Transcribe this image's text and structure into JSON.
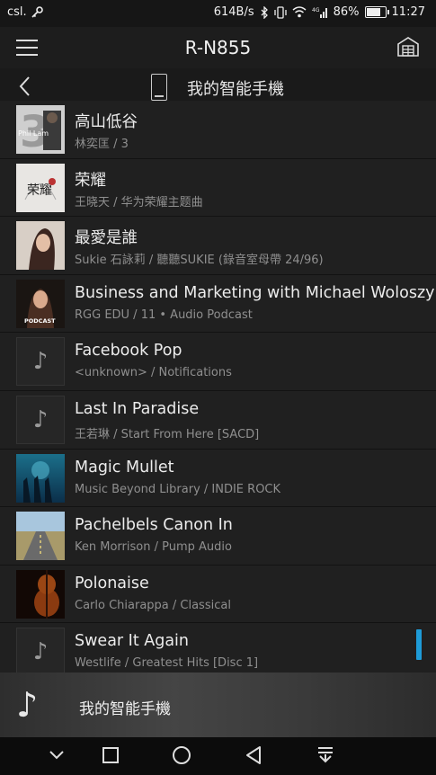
{
  "status_bar": {
    "carrier": "csl.",
    "speed": "614B/s",
    "battery": "86%",
    "battery_level": 0.86,
    "time": "11:27"
  },
  "app_bar": {
    "title": "R-N855",
    "menu_icon": "hamburger-menu-icon",
    "home_icon": "house-icon"
  },
  "sub_bar": {
    "title": "我的智能手機",
    "back_icon": "chevron-left-icon",
    "device_icon": "smartphone-icon"
  },
  "tracks": [
    {
      "title": "高山低谷",
      "subtitle": "林奕匡 / 3",
      "art": "album-art"
    },
    {
      "title": "荣耀",
      "subtitle": "王晓天 / 华为荣耀主题曲",
      "art": "album-art"
    },
    {
      "title": "最愛是誰",
      "subtitle": "Sukie 石詠莉 / 聽聽SUKIE (錄音室母帶 24/96)",
      "art": "album-art"
    },
    {
      "title": "Business and Marketing with Michael Woloszy…",
      "subtitle": "RGG EDU / 11 • Audio Podcast",
      "art": "album-art"
    },
    {
      "title": "Facebook Pop",
      "subtitle": "<unknown> / Notifications",
      "art": "music-note-icon"
    },
    {
      "title": "Last In Paradise",
      "subtitle": "王若琳 / Start From Here [SACD]",
      "art": "music-note-icon"
    },
    {
      "title": "Magic Mullet",
      "subtitle": "Music Beyond Library / INDIE ROCK",
      "art": "album-art"
    },
    {
      "title": "Pachelbels Canon In",
      "subtitle": "Ken Morrison / Pump Audio",
      "art": "album-art"
    },
    {
      "title": "Polonaise",
      "subtitle": "Carlo Chiarappa / Classical",
      "art": "album-art"
    },
    {
      "title": "Swear It Again",
      "subtitle": "Westlife / Greatest Hits [Disc 1]",
      "art": "music-note-icon"
    }
  ],
  "art_text": {
    "phil_lam": "Phil Lam",
    "phil_lam_num": "3",
    "podcast": "PODCAST",
    "rongyao": "荣耀"
  },
  "now_playing": {
    "title": "我的智能手機",
    "icon": "music-note-icon"
  },
  "accent_color": "#1e9bd7",
  "nav_bar": [
    "chevron-down-icon",
    "square-recents-icon",
    "circle-home-icon",
    "triangle-back-icon",
    "pull-down-icon"
  ]
}
